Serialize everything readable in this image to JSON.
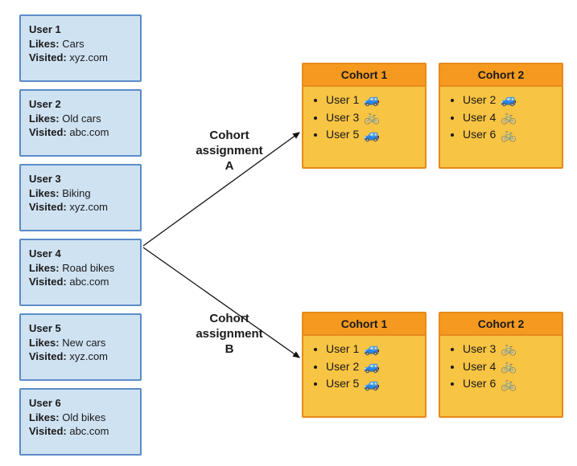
{
  "users": [
    {
      "name": "User 1",
      "likes_label": "Likes:",
      "likes": "Cars",
      "visited_label": "Visited:",
      "visited": "xyz.com"
    },
    {
      "name": "User 2",
      "likes_label": "Likes:",
      "likes": "Old cars",
      "visited_label": "Visited:",
      "visited": "abc.com"
    },
    {
      "name": "User 3",
      "likes_label": "Likes:",
      "likes": "Biking",
      "visited_label": "Visited:",
      "visited": "xyz.com"
    },
    {
      "name": "User 4",
      "likes_label": "Likes:",
      "likes": "Road bikes",
      "visited_label": "Visited:",
      "visited": "abc.com"
    },
    {
      "name": "User 5",
      "likes_label": "Likes:",
      "likes": "New cars",
      "visited_label": "Visited:",
      "visited": "xyz.com"
    },
    {
      "name": "User 6",
      "likes_label": "Likes:",
      "likes": "Old bikes",
      "visited_label": "Visited:",
      "visited": "abc.com"
    }
  ],
  "assignments": {
    "A": {
      "line1": "Cohort",
      "line2": "assignment",
      "line3": "A"
    },
    "B": {
      "line1": "Cohort",
      "line2": "assignment",
      "line3": "B"
    }
  },
  "icons": {
    "car": "🚙",
    "bike": "🚲"
  },
  "cohort_groups": {
    "A": {
      "1": {
        "title": "Cohort 1",
        "items": [
          {
            "label": "User 1",
            "icon": "car"
          },
          {
            "label": "User 3",
            "icon": "bike"
          },
          {
            "label": "User 5",
            "icon": "car"
          }
        ]
      },
      "2": {
        "title": "Cohort 2",
        "items": [
          {
            "label": "User 2",
            "icon": "car"
          },
          {
            "label": "User 4",
            "icon": "bike"
          },
          {
            "label": "User 6",
            "icon": "bike"
          }
        ]
      }
    },
    "B": {
      "1": {
        "title": "Cohort 1",
        "items": [
          {
            "label": "User 1",
            "icon": "car"
          },
          {
            "label": "User 2",
            "icon": "car"
          },
          {
            "label": "User 5",
            "icon": "car"
          }
        ]
      },
      "2": {
        "title": "Cohort 2",
        "items": [
          {
            "label": "User 3",
            "icon": "bike"
          },
          {
            "label": "User 4",
            "icon": "bike"
          },
          {
            "label": "User 6",
            "icon": "bike"
          }
        ]
      }
    }
  }
}
